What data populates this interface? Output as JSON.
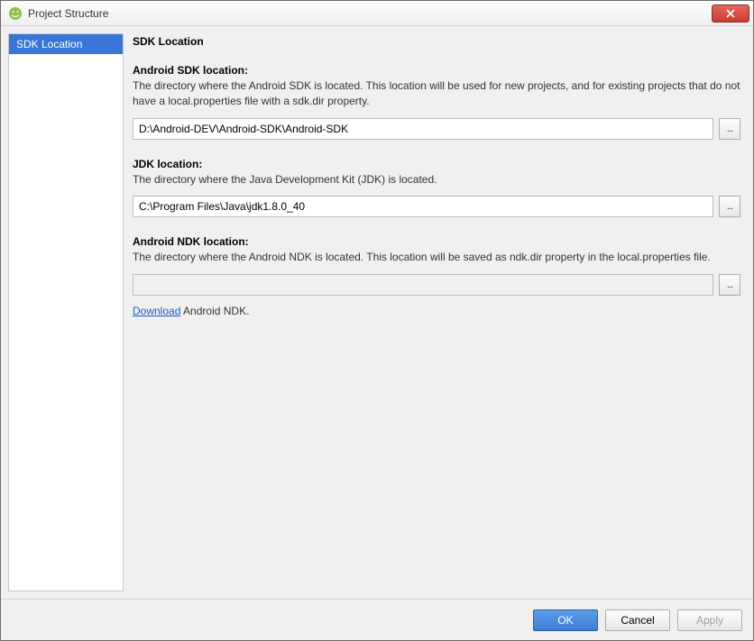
{
  "window": {
    "title": "Project Structure"
  },
  "sidebar": {
    "items": [
      {
        "label": "SDK Location",
        "selected": true
      }
    ]
  },
  "main": {
    "heading": "SDK Location",
    "sdk": {
      "label": "Android SDK location:",
      "desc": "The directory where the Android SDK is located. This location will be used for new projects, and for existing projects that do not have a local.properties file with a sdk.dir property.",
      "value": "D:\\Android-DEV\\Android-SDK\\Android-SDK",
      "browse": "..."
    },
    "jdk": {
      "label": "JDK location:",
      "desc": "The directory where the Java Development Kit (JDK) is located.",
      "value": "C:\\Program Files\\Java\\jdk1.8.0_40",
      "browse": "..."
    },
    "ndk": {
      "label": "Android NDK location:",
      "desc": "The directory where the Android NDK is located. This location will be saved as ndk.dir property in the local.properties file.",
      "value": "",
      "browse": "...",
      "download_link": "Download",
      "download_suffix": " Android NDK."
    }
  },
  "footer": {
    "ok": "OK",
    "cancel": "Cancel",
    "apply": "Apply"
  }
}
